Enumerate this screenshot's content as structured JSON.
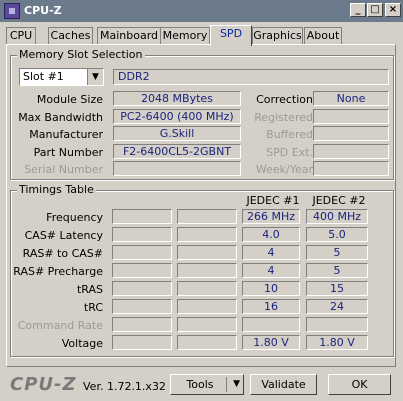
{
  "window": {
    "title": "CPU-Z",
    "min_glyph": "_",
    "max_glyph": "□",
    "close_glyph": "×"
  },
  "tabs": [
    {
      "label": "CPU"
    },
    {
      "label": "Caches"
    },
    {
      "label": "Mainboard"
    },
    {
      "label": "Memory"
    },
    {
      "label": "SPD"
    },
    {
      "label": "Graphics"
    },
    {
      "label": "About"
    }
  ],
  "active_tab": "SPD",
  "slot_selection": {
    "title": "Memory Slot Selection",
    "slot_value": "Slot #1",
    "mem_type": "DDR2",
    "rows": [
      {
        "label": "Module Size",
        "value": "2048 MBytes",
        "rlabel": "Correction",
        "rvalue": "None"
      },
      {
        "label": "Max Bandwidth",
        "value": "PC2-6400 (400 MHz)",
        "rlabel": "Registered",
        "rvalue": ""
      },
      {
        "label": "Manufacturer",
        "value": "G.Skill",
        "rlabel": "Buffered",
        "rvalue": ""
      },
      {
        "label": "Part Number",
        "value": "F2-6400CL5-2GBNT",
        "rlabel": "SPD Ext.",
        "rvalue": ""
      },
      {
        "label": "Serial Number",
        "value": "",
        "rlabel": "Week/Year",
        "rvalue": ""
      }
    ]
  },
  "timings": {
    "title": "Timings Table",
    "col_headers": [
      "JEDEC #1",
      "JEDEC #2"
    ],
    "rows": [
      {
        "label": "Frequency",
        "j1": "266 MHz",
        "j2": "400 MHz"
      },
      {
        "label": "CAS# Latency",
        "j1": "4.0",
        "j2": "5.0"
      },
      {
        "label": "RAS# to CAS#",
        "j1": "4",
        "j2": "5"
      },
      {
        "label": "RAS# Precharge",
        "j1": "4",
        "j2": "5"
      },
      {
        "label": "tRAS",
        "j1": "10",
        "j2": "15"
      },
      {
        "label": "tRC",
        "j1": "16",
        "j2": "24"
      },
      {
        "label": "Command Rate",
        "j1": "",
        "j2": ""
      },
      {
        "label": "Voltage",
        "j1": "1.80 V",
        "j2": "1.80 V"
      }
    ]
  },
  "footer": {
    "logo": "CPU-Z",
    "version": "Ver. 1.72.1.x32",
    "tools_label": "Tools",
    "validate_label": "Validate",
    "ok_label": "OK"
  }
}
